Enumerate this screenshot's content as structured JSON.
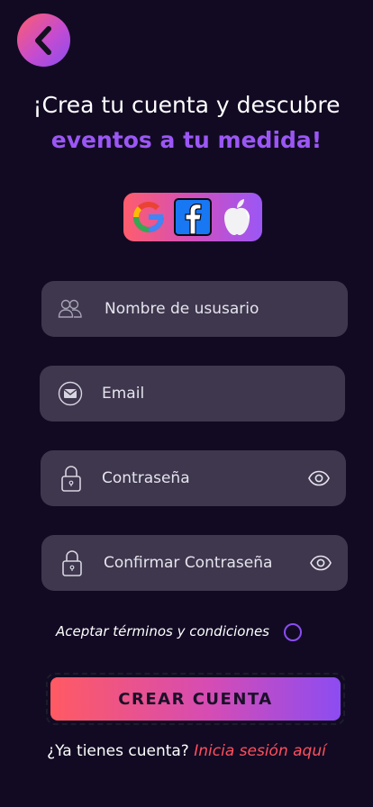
{
  "header": {
    "line1": "¡Crea tu cuenta y descubre",
    "line2": "eventos a tu medida!"
  },
  "social": {
    "google_icon": "google-icon",
    "facebook_icon": "facebook-icon",
    "apple_icon": "apple-icon"
  },
  "form": {
    "username_label": "Nombre de ususario",
    "email_label": "Email",
    "password_label": "Contraseña",
    "confirm_password_label": "Confirmar Contraseña"
  },
  "terms": {
    "label": "Aceptar términos y condiciones"
  },
  "cta": {
    "label": "CREAR CUENTA"
  },
  "login": {
    "prompt": "¿Ya tienes cuenta?",
    "link": "Inicia sesión aquí"
  },
  "colors": {
    "background": "#120a23",
    "field": "#3e374d",
    "accent_purple": "#9b57f5",
    "accent_red": "#ff4f5e"
  }
}
